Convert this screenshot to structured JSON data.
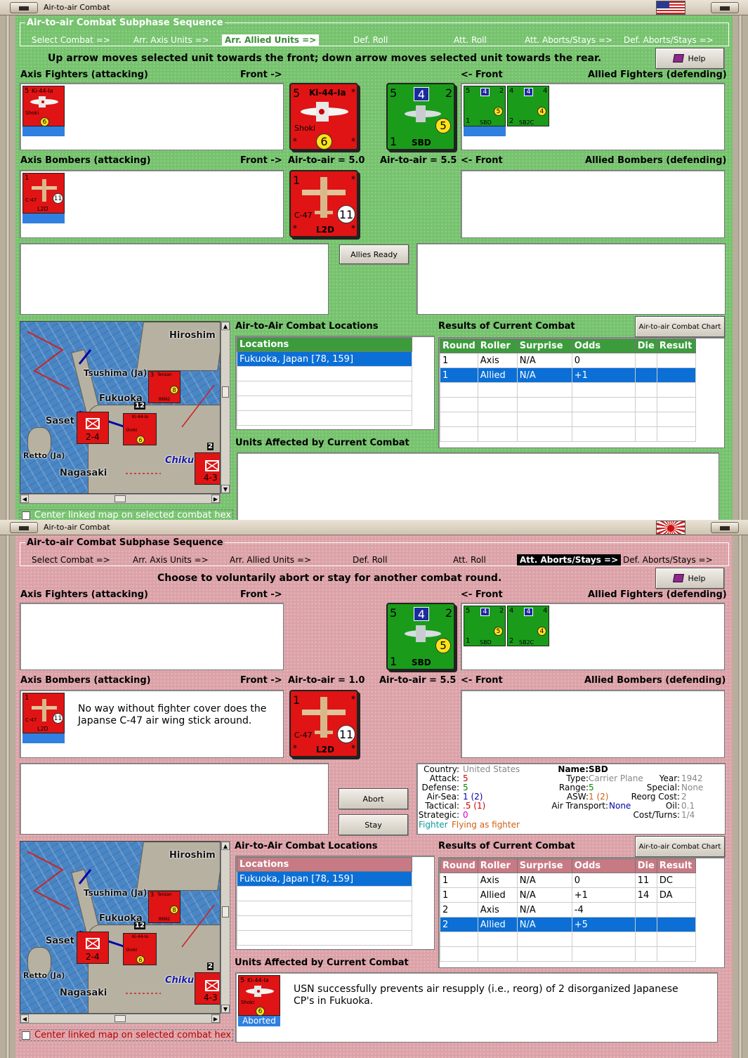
{
  "window_title": "Air-to-air Combat",
  "sequence": {
    "title": "Air-to-air Combat Subphase Sequence",
    "items": [
      "Select Combat =>",
      "Arr. Axis Units =>",
      "Arr. Allied Units =>",
      "Def. Roll",
      "Att. Roll",
      "Att. Aborts/Stays =>",
      "Def. Aborts/Stays =>"
    ]
  },
  "labels": {
    "axis_fighters": "Axis Fighters (attacking)",
    "allied_fighters": "Allied Fighters (defending)",
    "axis_bombers": "Axis Bombers (attacking)",
    "allied_bombers": "Allied Bombers (defending)",
    "front_right": "Front ->",
    "front_left": "<- Front",
    "locations_title": "Air-to-Air Combat Locations",
    "results_title": "Results of Current Combat",
    "affected_title": "Units Affected by Current Combat",
    "help": "Help",
    "chart_btn": "Air-to-air Combat Chart",
    "center_map": "Center linked map on selected combat hex"
  },
  "screen1": {
    "instruction": "Up arrow moves selected unit towards the front; down arrow moves selected unit towards the rear.",
    "axis_air": "Air-to-air = 5.0",
    "allied_air": "Air-to-air = 5.5",
    "allies_ready": "Allies Ready",
    "results": [
      {
        "round": "1",
        "roller": "Axis",
        "surprise": "N/A",
        "odds": "0",
        "die": "",
        "result": ""
      },
      {
        "round": "1",
        "roller": "Allied",
        "surprise": "N/A",
        "odds": "+1",
        "die": "",
        "result": ""
      }
    ]
  },
  "screen2": {
    "instruction": "Choose to voluntarily abort or stay for another combat round.",
    "axis_air": "Air-to-air = 1.0",
    "allied_air": "Air-to-air = 5.5",
    "abort": "Abort",
    "stay": "Stay",
    "bomber_note": "No way without fighter cover does the Japanse C-47 air wing stick around.",
    "affected_note": "USN successfully prevents air resupply (i.e., reorg) of 2 disorganized Japanese CP's in Fukuoka.",
    "aborted": "Aborted",
    "results": [
      {
        "round": "1",
        "roller": "Axis",
        "surprise": "N/A",
        "odds": "0",
        "die": "11",
        "result": "DC"
      },
      {
        "round": "1",
        "roller": "Allied",
        "surprise": "N/A",
        "odds": "+1",
        "die": "14",
        "result": "DA"
      },
      {
        "round": "2",
        "roller": "Axis",
        "surprise": "N/A",
        "odds": "-4",
        "die": "",
        "result": ""
      },
      {
        "round": "2",
        "roller": "Allied",
        "surprise": "N/A",
        "odds": "+5",
        "die": "",
        "result": ""
      }
    ],
    "unit_info": {
      "country_k": "Country:",
      "country": "United States",
      "attack_k": "Attack:",
      "attack": "5",
      "defense_k": "Defense:",
      "defense": "5",
      "airsea_k": "Air-Sea:",
      "airsea": "1 (2)",
      "tactical_k": "Tactical:",
      "tactical": ".5 (1)",
      "strategic_k": "Strategic:",
      "strategic": "0",
      "fighter": "Fighter",
      "flying": "Flying as fighter",
      "name_k": "Name:",
      "name": "SBD",
      "type_k": "Type:",
      "type": "Carrier Plane",
      "year_k": "Year:",
      "year": "1942",
      "range_k": "Range:",
      "range": "5",
      "special_k": "Special:",
      "special": "None",
      "asw_k": "ASW:",
      "asw": "1 (2)",
      "reorg_k": "Reorg Cost:",
      "reorg": "2",
      "transport_k": "Air Transport:",
      "transport": "None",
      "oil_k": "Oil:",
      "oil": "0.1",
      "cost_k": "Cost/Turns:",
      "cost": "1/4"
    }
  },
  "results_headers": [
    "Round",
    "Roller",
    "Surprise",
    "Odds",
    "Die",
    "Result"
  ],
  "locations_header": "Locations",
  "location": "Fukuoka, Japan [78, 159]",
  "units": {
    "ki44": {
      "name": "Ki-44-Ia",
      "nick": "Shoki",
      "atk": "5",
      "rng": "6"
    },
    "c47": {
      "name": "C-47",
      "nick": "L2D",
      "atk": "1",
      "rng": "11"
    },
    "sbd": {
      "name": "SBD",
      "atk": "5",
      "def": "4",
      "a2": "2",
      "tac": "1",
      "rng": "5"
    },
    "sb2c": {
      "name": "SB2C",
      "atk": "4",
      "def": "4",
      "a2": "4",
      "tac": "2",
      "rng": "4"
    }
  },
  "map": {
    "hiroshima": "Hiroshim",
    "tsushima": "Tsushima (Ja)",
    "fukuoka": "Fukuoka",
    "sasebo": "Saset",
    "retto": "Retto (Ja)",
    "nagasaki": "Nagasaki",
    "chikugo": "Chiku",
    "stack_count": "12",
    "stack_count2": "2",
    "unit_a": "2-4",
    "unit_b": "4-3",
    "tenzan_rng": "8",
    "tenzan_nick": "B6N2",
    "tenzan_name": "Tenzan",
    "shoki_rng": "6",
    "shoki_nick": "Shoki",
    "shoki_name": "Ki-44-Ia",
    "small_3": "3"
  },
  "colors": {
    "green_bg": "#76c26e",
    "pink_bg": "#dba2a8",
    "axis_red": "#e01414",
    "allied_green": "#1a9c1a",
    "select_blue": "#0b6fd6"
  }
}
